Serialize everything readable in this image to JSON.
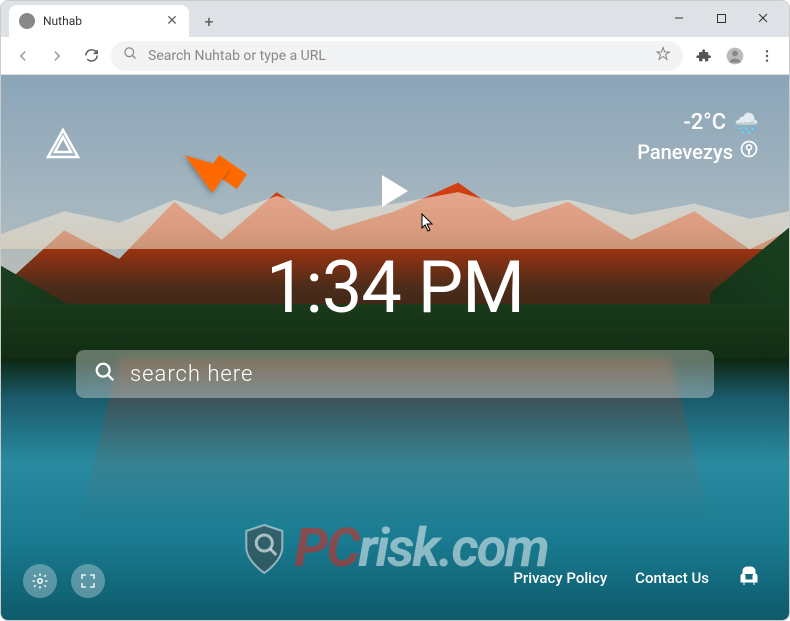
{
  "tab": {
    "title": "Nuthab"
  },
  "addressbar": {
    "placeholder": "Search Nuhtab or type a URL"
  },
  "weather": {
    "temp": "-2°C",
    "location": "Panevezys"
  },
  "clock": {
    "time": "1:34 PM"
  },
  "search": {
    "placeholder": "search here"
  },
  "footer": {
    "privacy": "Privacy Policy",
    "contact": "Contact Us"
  },
  "watermark": {
    "p": "P",
    "c": "C",
    "rest": "risk.com"
  }
}
